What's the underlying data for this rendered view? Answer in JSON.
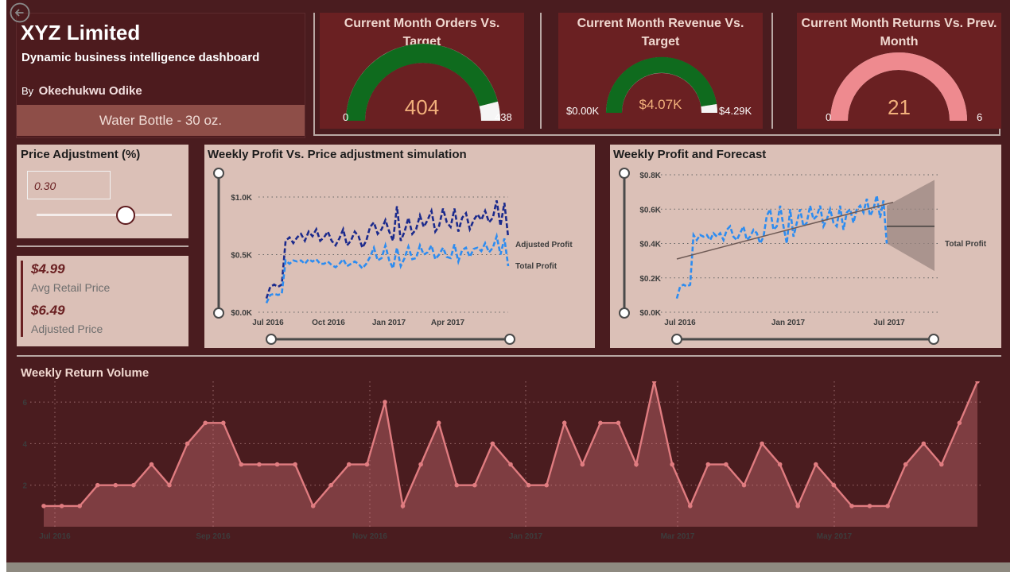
{
  "header": {
    "back_icon": "back-arrow-icon",
    "company": "XYZ Limited",
    "subtitle": "Dynamic business intelligence dashboard",
    "by_label": "By",
    "author": "Okechukwu Odike",
    "product": "Water Bottle - 30 oz."
  },
  "kpis": [
    {
      "title": "Current Month Orders Vs. Target",
      "value": "404",
      "min": "0",
      "max": "438",
      "fraction": 0.92,
      "fill_color": "#0f6b1e"
    },
    {
      "title": "Current Month Revenue Vs. Target",
      "value": "$4.07K",
      "min": "$0.00K",
      "max": "$4.29K",
      "fraction": 0.95,
      "fill_color": "#0f6b1e"
    },
    {
      "title": "Current Month Returns Vs. Prev. Month",
      "value": "21",
      "min": "0",
      "max": "6",
      "fraction": 1.0,
      "fill_color": "#ee8a8f"
    }
  ],
  "price_adjustment": {
    "title": "Price Adjustment (%)",
    "value": "0.30",
    "slider_fraction": 0.66
  },
  "prices": {
    "avg_value": "$4.99",
    "avg_label": "Avg Retail Price",
    "adj_value": "$6.49",
    "adj_label": "Adjusted Price"
  },
  "colors": {
    "background": "#4a1c1f",
    "kpi_card": "#6a2022",
    "card": "#dbc0b7",
    "adjusted_profit": "#1b2a8c",
    "total_profit": "#2d8cf0",
    "returns": "#e07c80",
    "target_marker": "#f5f5f5"
  },
  "chart_data": [
    {
      "type": "line",
      "title": "Weekly Profit Vs. Price adjustment simulation",
      "x_ticks": [
        "Jul 2016",
        "Oct 2016",
        "Jan 2017",
        "Apr 2017"
      ],
      "y_ticks": [
        "$0.0K",
        "$0.5K",
        "$1.0K"
      ],
      "ylim": [
        0,
        1.0
      ],
      "series": [
        {
          "name": "Adjusted Profit",
          "color": "#1b2a8c",
          "values": [
            0.12,
            0.22,
            0.24,
            0.22,
            0.24,
            0.62,
            0.65,
            0.6,
            0.65,
            0.68,
            0.62,
            0.7,
            0.66,
            0.72,
            0.62,
            0.65,
            0.7,
            0.62,
            0.58,
            0.64,
            0.72,
            0.58,
            0.62,
            0.7,
            0.66,
            0.56,
            0.62,
            0.74,
            0.78,
            0.68,
            0.72,
            0.8,
            0.7,
            0.62,
            0.92,
            0.62,
            0.7,
            0.82,
            0.68,
            0.72,
            0.84,
            0.74,
            0.8,
            0.88,
            0.7,
            0.75,
            0.9,
            0.78,
            0.74,
            0.9,
            0.7,
            0.82,
            0.86,
            0.72,
            0.8,
            0.85,
            0.8,
            0.88,
            0.78,
            0.82,
            0.97,
            0.75,
            0.95,
            0.65
          ]
        },
        {
          "name": "Total Profit",
          "color": "#2d8cf0",
          "values": [
            0.08,
            0.15,
            0.16,
            0.15,
            0.16,
            0.45,
            0.42,
            0.45,
            0.44,
            0.45,
            0.42,
            0.46,
            0.44,
            0.46,
            0.42,
            0.42,
            0.44,
            0.41,
            0.39,
            0.42,
            0.46,
            0.4,
            0.42,
            0.44,
            0.42,
            0.38,
            0.42,
            0.48,
            0.56,
            0.45,
            0.47,
            0.58,
            0.45,
            0.38,
            0.56,
            0.4,
            0.47,
            0.57,
            0.46,
            0.47,
            0.58,
            0.5,
            0.52,
            0.58,
            0.46,
            0.5,
            0.56,
            0.48,
            0.47,
            0.59,
            0.44,
            0.54,
            0.56,
            0.48,
            0.55,
            0.56,
            0.53,
            0.6,
            0.52,
            0.56,
            0.66,
            0.5,
            0.64,
            0.4
          ]
        }
      ]
    },
    {
      "type": "line",
      "title": "Weekly Profit and Forecast",
      "x_ticks": [
        "Jul 2016",
        "Jan 2017",
        "Jul 2017"
      ],
      "y_ticks": [
        "$0.0K",
        "$0.2K",
        "$0.4K",
        "$0.6K",
        "$0.8K"
      ],
      "ylim": [
        0,
        0.8
      ],
      "series": [
        {
          "name": "Total Profit",
          "color": "#2d8cf0",
          "values": [
            0.08,
            0.15,
            0.16,
            0.15,
            0.16,
            0.45,
            0.42,
            0.45,
            0.44,
            0.45,
            0.42,
            0.46,
            0.44,
            0.46,
            0.42,
            0.48,
            0.5,
            0.44,
            0.42,
            0.46,
            0.5,
            0.42,
            0.44,
            0.48,
            0.46,
            0.4,
            0.44,
            0.56,
            0.6,
            0.48,
            0.5,
            0.62,
            0.5,
            0.4,
            0.6,
            0.44,
            0.52,
            0.6,
            0.5,
            0.52,
            0.62,
            0.54,
            0.56,
            0.62,
            0.5,
            0.54,
            0.6,
            0.52,
            0.5,
            0.62,
            0.48,
            0.58,
            0.6,
            0.52,
            0.6,
            0.62,
            0.58,
            0.66,
            0.56,
            0.6,
            0.68,
            0.55,
            0.65,
            0.4
          ]
        }
      ],
      "trend": [
        0.31,
        0.64
      ],
      "forecast": {
        "value": 0.5,
        "upper_start": 0.62,
        "upper_end": 0.77,
        "lower_start": 0.4,
        "lower_end": 0.24
      }
    },
    {
      "type": "area",
      "title": "Weekly Return Volume",
      "x_ticks": [
        "Jul 2016",
        "Sep 2016",
        "Nov 2016",
        "Jan 2017",
        "Mar 2017",
        "May 2017"
      ],
      "y_ticks": [
        "2",
        "4",
        "6"
      ],
      "ylim": [
        0,
        7
      ],
      "series": [
        {
          "name": "Returns",
          "color": "#e07c80",
          "values": [
            1,
            1,
            1,
            2,
            2,
            2,
            3,
            2,
            4,
            5,
            5,
            3,
            3,
            3,
            3,
            1,
            2,
            3,
            3,
            6,
            1,
            3,
            5,
            2,
            2,
            4,
            3,
            2,
            2,
            5,
            3,
            5,
            5,
            3,
            7,
            3,
            1,
            3,
            3,
            2,
            4,
            3,
            1,
            3,
            2,
            1,
            1,
            1,
            3,
            4,
            3,
            5,
            7
          ]
        }
      ]
    }
  ]
}
